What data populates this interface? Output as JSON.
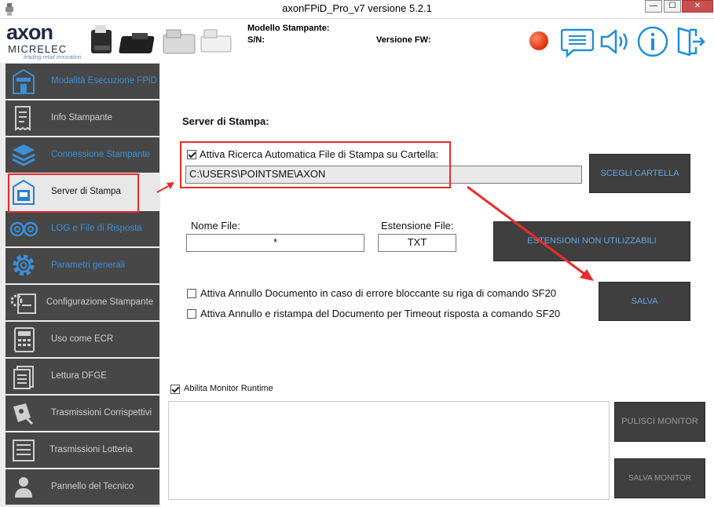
{
  "window": {
    "title": "axonFPiD_Pro_v7 versione 5.2.1",
    "minimize_label": "—",
    "maximize_label": "☐",
    "close_label": "✕"
  },
  "header": {
    "logo_brand": "axon",
    "logo_sub": "MICRELEC",
    "logo_tagline": "leading retail innovation",
    "model_label": "Modello Stampante:",
    "serial_label": "S/N:",
    "firmware_label": "Versione FW:",
    "status_led_color": "#e53b10",
    "icons": [
      "message-icon",
      "speaker-icon",
      "info-icon",
      "exit-icon"
    ]
  },
  "sidebar": {
    "items": [
      {
        "label": "Modalità Esecuzione FPiD",
        "icon": "building-icon"
      },
      {
        "label": "Info Stampante",
        "icon": "receipt-icon"
      },
      {
        "label": "Connessione Stampante",
        "icon": "layers-icon"
      },
      {
        "label": "Server di Stampa",
        "icon": "print-server-icon"
      },
      {
        "label": "LOG e File di Risposta",
        "icon": "tape-icon"
      },
      {
        "label": "Parametri generali",
        "icon": "gear-icon"
      },
      {
        "label": "Configurazione Stampante",
        "icon": "config-icon"
      },
      {
        "label": "Uso come ECR",
        "icon": "calculator-icon"
      },
      {
        "label": "Lettura DFGE",
        "icon": "document-icon"
      },
      {
        "label": "Trasmissioni Corrispettivi",
        "icon": "transmit-icon"
      },
      {
        "label": "Trasmissioni Lotteria",
        "icon": "lottery-icon"
      },
      {
        "label": "Pannello del Tecnico",
        "icon": "user-icon"
      }
    ],
    "active_index": 3
  },
  "main": {
    "section_title": "Server di Stampa:",
    "auto_search_label": "Attiva Ricerca Automatica File di Stampa su Cartella:",
    "auto_search_checked": true,
    "folder_path": "C:\\USERS\\POINTSME\\AXON",
    "choose_folder_button": "SCEGLI CARTELLA",
    "file_name_label": "Nome File:",
    "file_name_value": "*",
    "extension_label": "Estensione File:",
    "extension_value": "TXT",
    "unused_ext_button": "ESTENSIONI NON UTILIZZABILI",
    "save_button": "SALVA",
    "cancel_on_error_label": "Attiva Annullo Documento in caso di errore bloccante su riga di comando SF20",
    "cancel_on_error_checked": false,
    "cancel_reprint_label": "Attiva Annullo e ristampa del Documento per Timeout risposta a comando SF20",
    "cancel_reprint_checked": false,
    "monitor_label": "Abilita Monitor Runtime",
    "monitor_checked": true,
    "clear_monitor_button": "PULISCI MONITOR",
    "save_monitor_button": "SALVA MONITOR"
  },
  "colors": {
    "sidebar_item_bg": "#474747",
    "sidebar_active_bg": "#e8e8e8",
    "accent_blue": "#3a8fd9",
    "dark_button": "#3f3f3f",
    "highlight_red": "#ee2a2a"
  }
}
